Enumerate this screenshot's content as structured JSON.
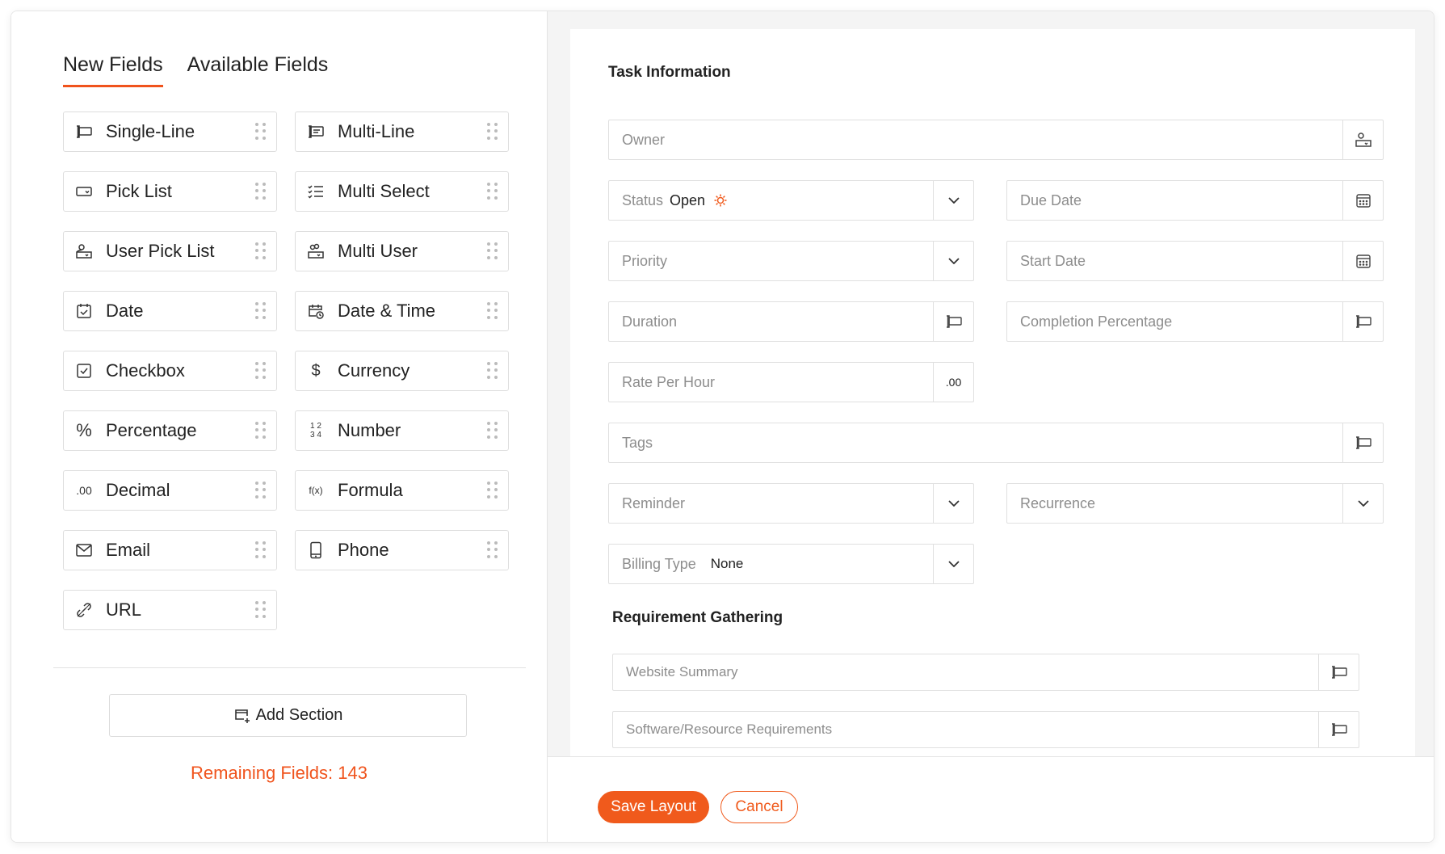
{
  "tabs": {
    "new_fields": "New Fields",
    "available_fields": "Available Fields"
  },
  "fields": [
    {
      "label": "Single-Line",
      "icon": "single-line-icon"
    },
    {
      "label": "Multi-Line",
      "icon": "multi-line-icon"
    },
    {
      "label": "Pick List",
      "icon": "pick-list-icon"
    },
    {
      "label": "Multi Select",
      "icon": "multi-select-icon"
    },
    {
      "label": "User Pick List",
      "icon": "user-pick-list-icon"
    },
    {
      "label": "Multi User",
      "icon": "multi-user-icon"
    },
    {
      "label": "Date",
      "icon": "date-icon"
    },
    {
      "label": "Date & Time",
      "icon": "date-time-icon"
    },
    {
      "label": "Checkbox",
      "icon": "checkbox-icon"
    },
    {
      "label": "Currency",
      "icon": "currency-icon"
    },
    {
      "label": "Percentage",
      "icon": "percentage-icon"
    },
    {
      "label": "Number",
      "icon": "number-icon"
    },
    {
      "label": "Decimal",
      "icon": "decimal-icon"
    },
    {
      "label": "Formula",
      "icon": "formula-icon"
    },
    {
      "label": "Email",
      "icon": "email-icon"
    },
    {
      "label": "Phone",
      "icon": "phone-icon"
    },
    {
      "label": "URL",
      "icon": "url-icon"
    }
  ],
  "icon_text": {
    "currency": "$",
    "percentage": "%",
    "number": "1 2\n3 4",
    "decimal": ".00",
    "formula": "f(x)"
  },
  "add_section_label": "Add Section",
  "remaining_fields": "Remaining Fields: 143",
  "layout": {
    "section1_title": "Task Information",
    "owner": "Owner",
    "status_label": "Status",
    "status_value": "Open",
    "due_date": "Due Date",
    "priority": "Priority",
    "start_date": "Start Date",
    "duration": "Duration",
    "completion_percentage": "Completion Percentage",
    "rate_per_hour": "Rate Per Hour",
    "rate_suffix": ".00",
    "tags": "Tags",
    "reminder": "Reminder",
    "recurrence": "Recurrence",
    "billing_type_label": "Billing Type",
    "billing_type_value": "None",
    "section2_title": "Requirement Gathering",
    "website_summary": "Website Summary",
    "software_requirements": "Software/Resource Requirements"
  },
  "footer": {
    "save": "Save Layout",
    "cancel": "Cancel"
  },
  "colors": {
    "accent": "#f05a1c",
    "border": "#e0e0e0",
    "placeholder": "#8d8d8d"
  }
}
